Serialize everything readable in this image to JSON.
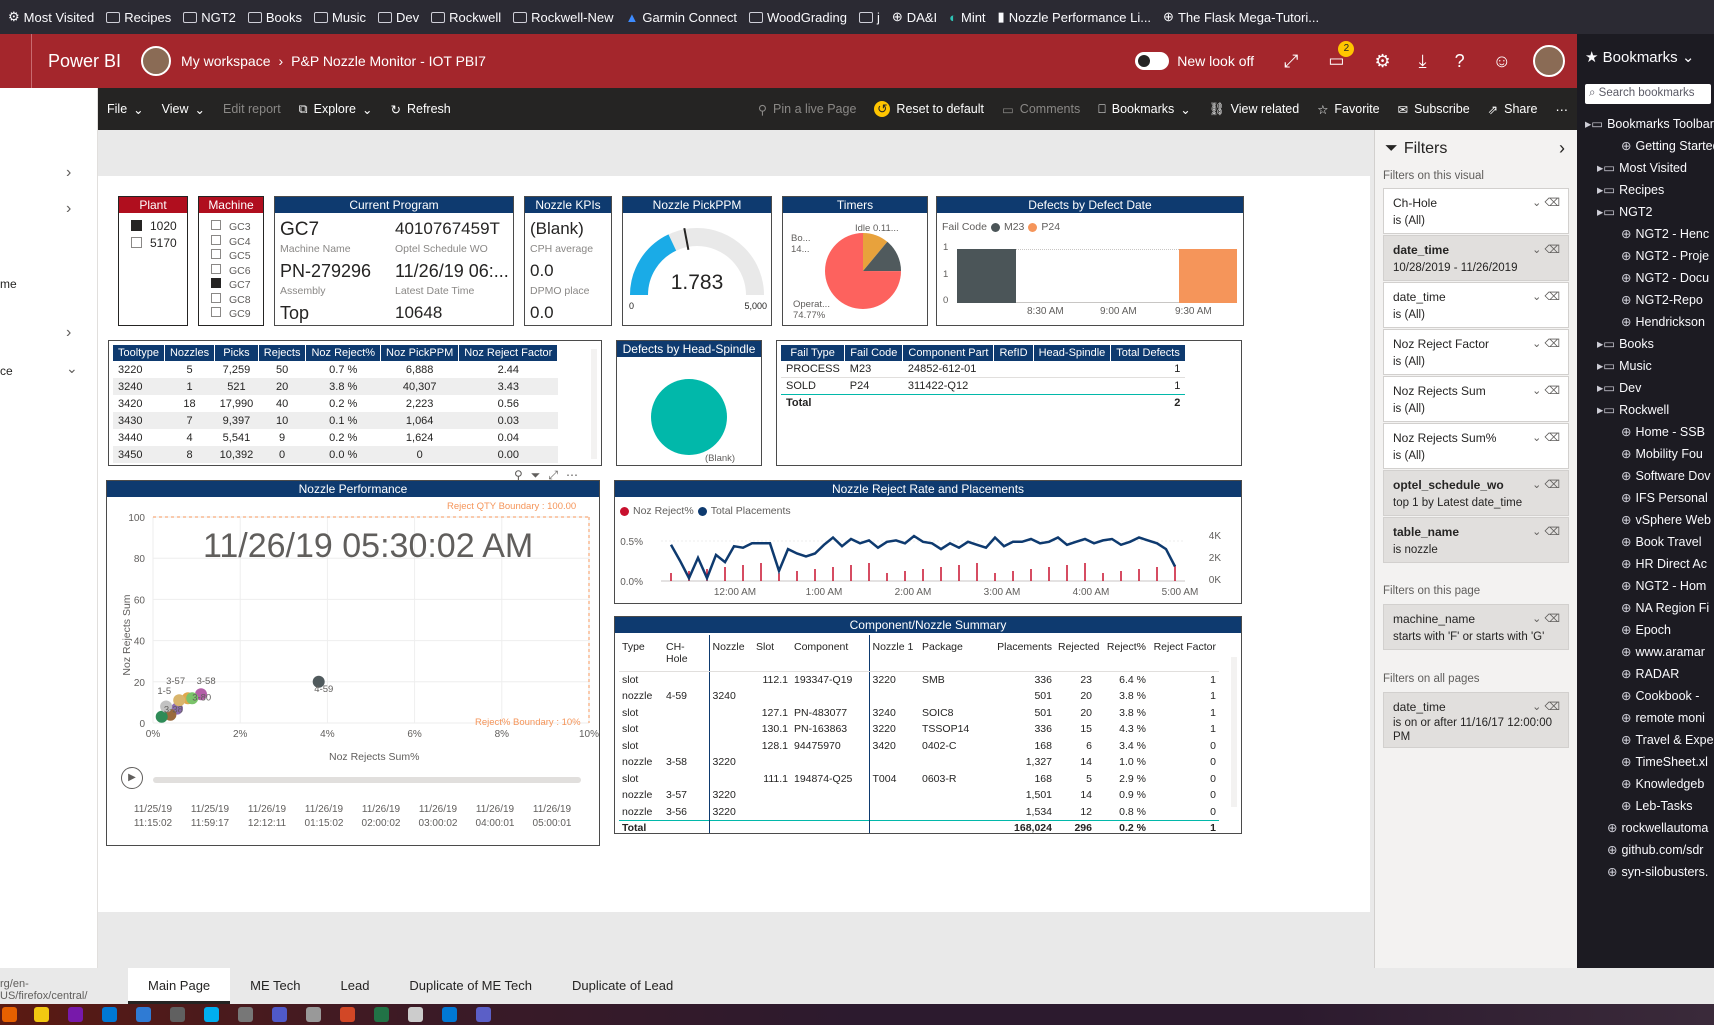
{
  "browser_bookmarks": [
    "Most Visited",
    "Recipes",
    "NGT2",
    "Books",
    "Music",
    "Dev",
    "Rockwell",
    "Rockwell-New",
    "Garmin Connect",
    "WoodGrading",
    "j",
    "DA&I",
    "Mint",
    "Nozzle Performance Li...",
    "The Flask Mega-Tutori..."
  ],
  "header": {
    "app": "Power BI",
    "workspace": "My workspace",
    "report": "P&P Nozzle Monitor - IOT PBI7",
    "new_look": "New look off",
    "notif_count": "2"
  },
  "toolbar": {
    "file": "File",
    "view": "View",
    "edit": "Edit report",
    "explore": "Explore",
    "refresh": "Refresh",
    "pin": "Pin a live Page",
    "reset": "Reset to default",
    "comments": "Comments",
    "bookmarks": "Bookmarks",
    "view_related": "View related",
    "favorite": "Favorite",
    "subscribe": "Subscribe",
    "share": "Share"
  },
  "leftnav": {
    "item_me": "me",
    "item_ce": "ce"
  },
  "slicers": {
    "plant_title": "Plant",
    "plant_items": [
      "1020",
      "5170"
    ],
    "machine_title": "Machine",
    "machine_items": [
      "GC3",
      "GC4",
      "GC5",
      "GC6",
      "GC7",
      "GC8",
      "GC9"
    ]
  },
  "current_program": {
    "title": "Current Program",
    "machine": "GC7",
    "machine_lbl": "Machine Name",
    "wo": "4010767459T",
    "wo_lbl": "Optel Schedule WO",
    "assembly": "PN-279296",
    "assembly_lbl": "Assembly",
    "date": "11/26/19 06:...",
    "date_lbl": "Latest Date Time",
    "side": "Top",
    "count": "10648"
  },
  "kpis": {
    "title": "Nozzle KPIs",
    "cph": "(Blank)",
    "cph_lbl": "CPH average",
    "dpmo": "0.0",
    "dpmo_lbl": "DPMO place",
    "third": "0.0"
  },
  "pickppm": {
    "title": "Nozzle PickPPM",
    "value": "1.783",
    "min": "0",
    "max": "5,000",
    "fraction": 0.36
  },
  "timers": {
    "title": "Timers",
    "labels": [
      "Idle 0.11...",
      "Bo... 14...",
      "Operat... 74.77%"
    ],
    "values": [
      0.11,
      0.14,
      0.7477
    ],
    "colors": [
      "#e8a23c",
      "#505a5d",
      "#fd625e"
    ]
  },
  "defects_date": {
    "title": "Defects by Defect Date",
    "legend_title": "Fail Code",
    "series": [
      "M23",
      "P24"
    ],
    "colors": [
      "#4b5558",
      "#f5955a"
    ],
    "yticks": [
      "1",
      "1",
      "0"
    ],
    "xticks": [
      "8:30 AM",
      "9:00 AM",
      "9:30 AM"
    ]
  },
  "tooltype": {
    "headers": [
      "Tooltype",
      "Nozzles",
      "Picks",
      "Rejects",
      "Noz Reject%",
      "Noz PickPPM",
      "Noz Reject Factor"
    ],
    "rows": [
      [
        "3220",
        "5",
        "7,259",
        "50",
        "0.7 %",
        "6,888",
        "2.44"
      ],
      [
        "3240",
        "1",
        "521",
        "20",
        "3.8 %",
        "40,307",
        "3.43"
      ],
      [
        "3420",
        "18",
        "17,990",
        "40",
        "0.2 %",
        "2,223",
        "0.56"
      ],
      [
        "3430",
        "7",
        "9,397",
        "10",
        "0.1 %",
        "1,064",
        "0.03"
      ],
      [
        "3440",
        "4",
        "5,541",
        "9",
        "0.2 %",
        "1,624",
        "0.04"
      ],
      [
        "3450",
        "8",
        "10,392",
        "0",
        "0.0 %",
        "0",
        "0.00"
      ]
    ]
  },
  "head_spindle": {
    "title": "Defects by Head-Spindle",
    "label": "(Blank)"
  },
  "fail_table": {
    "headers": [
      "Fail Type",
      "Fail Code",
      "Component Part",
      "RefID",
      "Head-Spindle",
      "Total Defects"
    ],
    "rows": [
      [
        "PROCESS",
        "M23",
        "24852-612-01",
        "",
        "",
        "1"
      ],
      [
        "SOLD",
        "P24",
        "311422-Q12",
        "",
        "",
        "1"
      ]
    ],
    "total_label": "Total",
    "total": "2"
  },
  "nozzle_perf": {
    "title": "Nozzle Performance",
    "timestamp": "11/26/19 05:30:02 AM",
    "yaxis": "Noz Rejects Sum",
    "xaxis": "Noz Rejects Sum%",
    "yticks": [
      "100",
      "80",
      "60",
      "40",
      "20",
      "0"
    ],
    "xticks": [
      "0%",
      "2%",
      "4%",
      "6%",
      "8%",
      "10%"
    ],
    "boundary_qty": "Reject QTY Boundary : 100.00",
    "boundary_pct": "Reject% Boundary : 10%",
    "point_labels": [
      "3-57",
      "3-58",
      "1-5",
      "3-80",
      "3-38",
      "4-59"
    ],
    "timeline": [
      "11/25/19 11:15:02",
      "11/25/19 11:59:17",
      "11/26/19 12:12:11",
      "11/26/19 01:15:02",
      "11/26/19 02:00:02",
      "11/26/19 03:00:02",
      "11/26/19 04:00:01",
      "11/26/19 05:00:01"
    ]
  },
  "reject_rate": {
    "title": "Nozzle Reject Rate and Placements",
    "legend": [
      "Noz Reject%",
      "Total Placements"
    ],
    "legend_colors": [
      "#c8102e",
      "#0e3a6f"
    ],
    "yleft": [
      "0.5%",
      "0.0%"
    ],
    "yright": [
      "4K",
      "2K",
      "0K"
    ],
    "xticks": [
      "12:00 AM",
      "1:00 AM",
      "2:00 AM",
      "3:00 AM",
      "4:00 AM",
      "5:00 AM"
    ],
    "placements": [
      2.5,
      1.4,
      0.2,
      1.6,
      0.2,
      1.8,
      1.3,
      2.4,
      2.3,
      2.6,
      2.6,
      2.6,
      0.7,
      2.2,
      1.9,
      1.7,
      1.9,
      2.5,
      3.0,
      2.4,
      2.9,
      2.6,
      2.8,
      2.3,
      2.7,
      2.8,
      2.6,
      3.1,
      2.7,
      2.6,
      2.2,
      2.6,
      2.3,
      2.7,
      2.5,
      2.3,
      3.0,
      2.4,
      2.7,
      2.7,
      2.9,
      2.6,
      2.7,
      3.0,
      2.5,
      2.7,
      2.9,
      2.6,
      2.8,
      2.9,
      2.5,
      2.7,
      3.0,
      2.8,
      2.6,
      2.2,
      1.0
    ]
  },
  "summary": {
    "title": "Component/Nozzle Summary",
    "headers": [
      "Type",
      "CH-Hole",
      "Nozzle",
      "Slot",
      "Component",
      "Nozzle 1",
      "Package",
      "Placements",
      "Rejected",
      "Reject%",
      "Reject Factor"
    ],
    "rows": [
      [
        "slot",
        "",
        "",
        "112.1",
        "193347-Q19",
        "3220",
        "SMB",
        "336",
        "23",
        "6.4 %",
        "1"
      ],
      [
        "nozzle",
        "4-59",
        "3240",
        "",
        "",
        "",
        "",
        "501",
        "20",
        "3.8 %",
        "1"
      ],
      [
        "slot",
        "",
        "",
        "127.1",
        "PN-483077",
        "3240",
        "SOIC8",
        "501",
        "20",
        "3.8 %",
        "1"
      ],
      [
        "slot",
        "",
        "",
        "130.1",
        "PN-163863",
        "3220",
        "TSSOP14",
        "336",
        "15",
        "4.3 %",
        "1"
      ],
      [
        "slot",
        "",
        "",
        "128.1",
        "94475970",
        "3420",
        "0402-C",
        "168",
        "6",
        "3.4 %",
        "0"
      ],
      [
        "nozzle",
        "3-58",
        "3220",
        "",
        "",
        "",
        "",
        "1,327",
        "14",
        "1.0 %",
        "0"
      ],
      [
        "slot",
        "",
        "",
        "111.1",
        "194874-Q25",
        "T004",
        "0603-R",
        "168",
        "5",
        "2.9 %",
        "0"
      ],
      [
        "nozzle",
        "3-57",
        "3220",
        "",
        "",
        "",
        "",
        "1,501",
        "14",
        "0.9 %",
        "0"
      ],
      [
        "nozzle",
        "3-56",
        "3220",
        "",
        "",
        "",
        "",
        "1,534",
        "12",
        "0.8 %",
        "0"
      ]
    ],
    "total": [
      "Total",
      "",
      "",
      "",
      "",
      "",
      "",
      "168,024",
      "296",
      "0.2 %",
      "1"
    ]
  },
  "filters": {
    "title": "Filters",
    "visual_hdr": "Filters on this visual",
    "page_hdr": "Filters on this page",
    "all_hdr": "Filters on all pages",
    "visual": [
      [
        "Ch-Hole",
        "is (All)"
      ],
      [
        "date_time",
        "10/28/2019 - 11/26/2019"
      ],
      [
        "date_time",
        "is (All)"
      ],
      [
        "Noz Reject Factor",
        "is (All)"
      ],
      [
        "Noz Rejects Sum",
        "is (All)"
      ],
      [
        "Noz Rejects Sum%",
        "is (All)"
      ],
      [
        "optel_schedule_wo",
        "top 1 by Latest date_time"
      ],
      [
        "table_name",
        "is nozzle"
      ]
    ],
    "page": [
      "machine_name",
      "starts with 'F' or starts with 'G'"
    ],
    "all": [
      "date_time",
      "is on or after 11/16/17 12:00:00 PM"
    ]
  },
  "sidebar": {
    "title": "Bookmarks",
    "search": "Search bookmarks",
    "items": [
      "Bookmarks Toolbar",
      "Getting Started",
      "Most Visited",
      "Recipes",
      "NGT2",
      "NGT2 - Henc",
      "NGT2 - Proje",
      "NGT2 - Docu",
      "NGT2-Repo",
      "Hendrickson",
      "Books",
      "Music",
      "Dev",
      "Rockwell",
      "Home - SSB",
      "Mobility Fou",
      "Software Dov",
      "IFS Personal",
      "vSphere Web",
      "Book Travel",
      "HR Direct Ac",
      "NGT2 - Hom",
      "NA Region Fi",
      "Epoch",
      "www.aramar",
      "RADAR",
      "Cookbook -",
      "remote moni",
      "Travel & Expe",
      "TimeSheet.xl",
      "Knowledgeb",
      "Leb-Tasks",
      "rockwellautoma",
      "github.com/sdr",
      "syn-silobusters."
    ]
  },
  "tabs": [
    "Main Page",
    "ME Tech",
    "Lead",
    "Duplicate of ME Tech",
    "Duplicate of Lead"
  ],
  "status_url": "rg/en-US/firefox/central/"
}
